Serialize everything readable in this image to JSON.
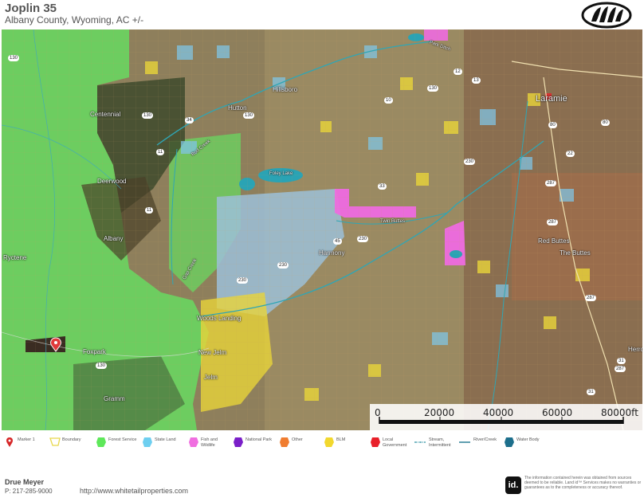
{
  "header": {
    "title": "Joplin 35",
    "subtitle": "Albany County, Wyoming,  AC +/-"
  },
  "map": {
    "places": [
      {
        "name": "Laramie",
        "size": "big"
      },
      {
        "name": "Centennial"
      },
      {
        "name": "Deerwood"
      },
      {
        "name": "Albany"
      },
      {
        "name": "Foxpark"
      },
      {
        "name": "Gramm"
      },
      {
        "name": "Harmony"
      },
      {
        "name": "Red Buttes"
      },
      {
        "name": "The Buttes"
      },
      {
        "name": "Woods Landing"
      },
      {
        "name": "New Jelm"
      },
      {
        "name": "Jelm"
      },
      {
        "name": "Hillsboro"
      },
      {
        "name": "Herron"
      },
      {
        "name": "Hutton"
      },
      {
        "name": "Ryctene"
      }
    ],
    "road_labels": [
      "130",
      "130",
      "130",
      "130",
      "11",
      "11",
      "12",
      "230",
      "230",
      "230",
      "230",
      "287",
      "287",
      "287",
      "287",
      "80",
      "80",
      "22",
      "45",
      "31",
      "31",
      "10",
      "13",
      "34",
      "33",
      "130"
    ],
    "feature_labels": [
      "Foley Lake",
      "Twin Buttes",
      "Gap Creek",
      "Park Ditch",
      "Rod Creek"
    ],
    "marker": {
      "name": "Marker 1",
      "icon": "map-pin-icon"
    },
    "scale": {
      "ticks": [
        "0",
        "20000",
        "40000",
        "60000",
        "80000ft"
      ]
    }
  },
  "legend": [
    {
      "label": "Marker 1",
      "icon": "map-pin-icon",
      "color": "#d62728"
    },
    {
      "label": "Boundary",
      "icon": "boundary-polygon-icon",
      "color": "#e8d84a"
    },
    {
      "label": "Forest Service",
      "icon": "forest-service-swatch-icon",
      "color": "#5ee85a"
    },
    {
      "label": "State Land",
      "icon": "state-land-swatch-icon",
      "color": "#6ecff0"
    },
    {
      "label": "Fish and Wildlife",
      "icon": "fish-wildlife-swatch-icon",
      "color": "#f06ee0"
    },
    {
      "label": "National Park",
      "icon": "national-park-swatch-icon",
      "color": "#7a1fc8"
    },
    {
      "label": "Other",
      "icon": "other-swatch-icon",
      "color": "#f07d30"
    },
    {
      "label": "BLM",
      "icon": "blm-swatch-icon",
      "color": "#f2d82e"
    },
    {
      "label": "Local Government",
      "icon": "local-government-swatch-icon",
      "color": "#e8202a"
    },
    {
      "label": "Stream, Intermittent",
      "icon": "stream-intermittent-line-icon",
      "color": "#2a8fa0"
    },
    {
      "label": "River/Creek",
      "icon": "river-creek-line-icon",
      "color": "#2a7f96"
    },
    {
      "label": "Water Body",
      "icon": "water-body-swatch-icon",
      "color": "#1d6f8c"
    }
  ],
  "footer": {
    "name": "Drue Meyer",
    "phone": "P: 217-285-9000",
    "url": "http://www.whitetailproperties.com",
    "disclaimer": "The information contained herein was obtained from sources deemed to be reliable. Land id™ Services makes no warranties or guarantees as to the completeness or accuracy thereof."
  }
}
